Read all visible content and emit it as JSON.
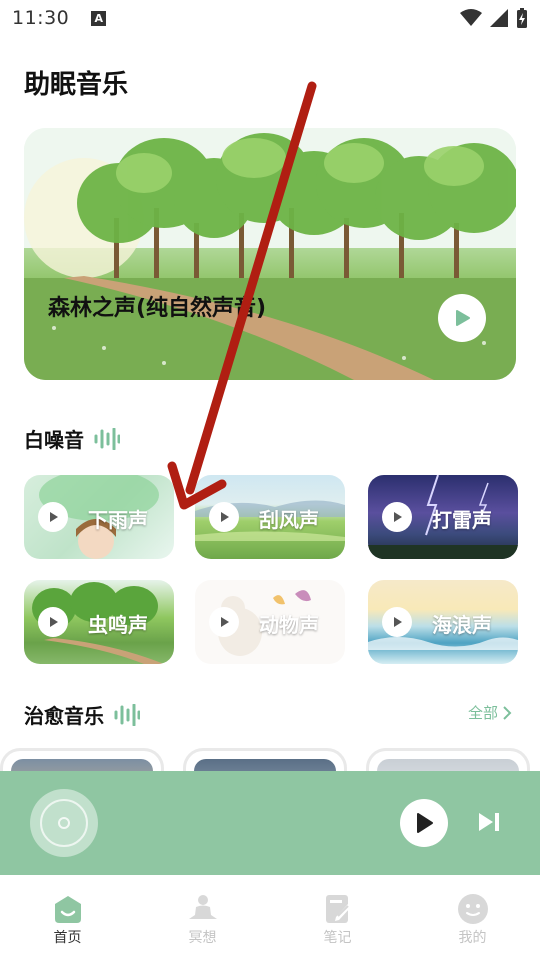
{
  "status_bar": {
    "time": "11:30",
    "notification_letter": "A"
  },
  "page_title": "助眠音乐",
  "hero": {
    "title": "森林之声(纯自然声音)"
  },
  "white_noise": {
    "title": "白噪音",
    "tiles": [
      {
        "label": "下雨声"
      },
      {
        "label": "刮风声"
      },
      {
        "label": "打雷声"
      },
      {
        "label": "虫鸣声"
      },
      {
        "label": "动物声"
      },
      {
        "label": "海浪声"
      }
    ]
  },
  "healing_music": {
    "title": "治愈音乐",
    "all_label": "全部"
  },
  "nav": {
    "items": [
      {
        "label": "首页"
      },
      {
        "label": "冥想"
      },
      {
        "label": "笔记"
      },
      {
        "label": "我的"
      }
    ]
  },
  "colors": {
    "accent": "#8fc6a2",
    "accent_text": "#7cbf9b",
    "annotation_arrow": "#b01e12"
  }
}
